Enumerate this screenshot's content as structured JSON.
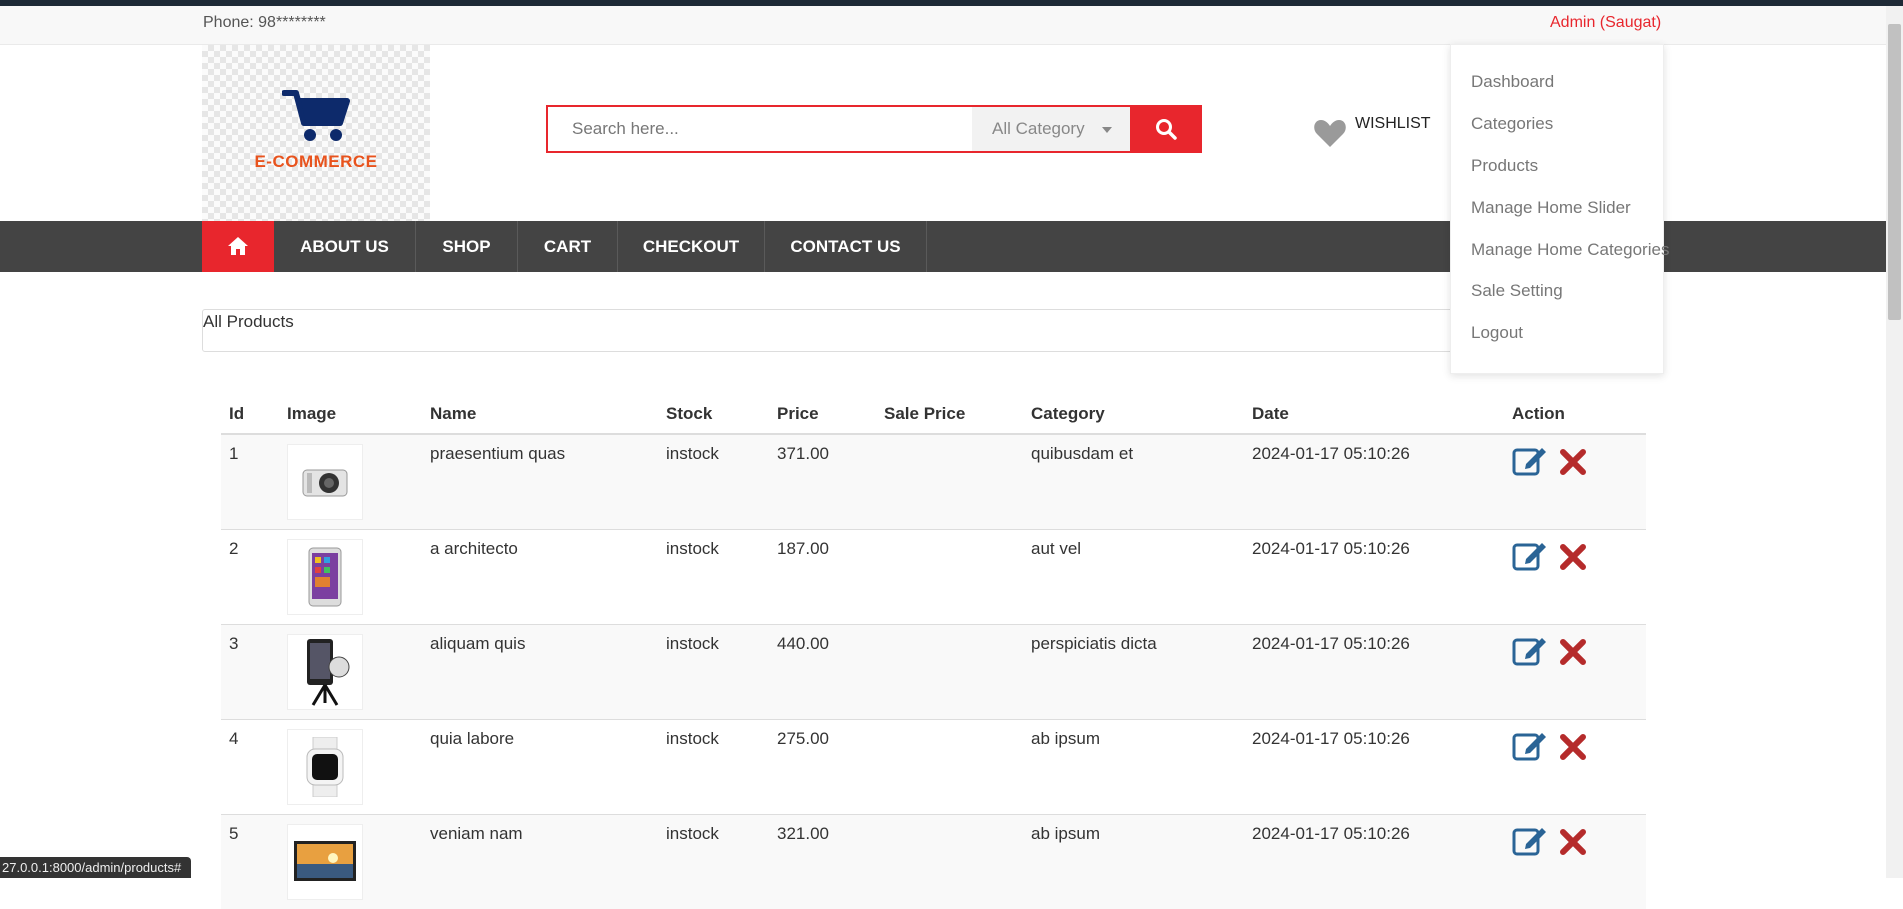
{
  "topbar": {
    "phone": "Phone: 98********",
    "admin_menu": "Admin (Saugat)"
  },
  "header": {
    "logo_text": "E-COMMERCE",
    "search": {
      "placeholder": "Search here...",
      "category_selected": "All Category"
    },
    "wishlist_label": "WISHLIST"
  },
  "nav": {
    "items": [
      "ABOUT US",
      "SHOP",
      "CART",
      "CHECKOUT",
      "CONTACT US"
    ]
  },
  "admin_dropdown": {
    "items": [
      "Dashboard",
      "Categories",
      "Products",
      "Manage Home Slider",
      "Manage Home Categories",
      "Sale Setting",
      "Logout"
    ]
  },
  "panel": {
    "title": "All Products"
  },
  "table": {
    "headers": [
      "Id",
      "Image",
      "Name",
      "Stock",
      "Price",
      "Sale Price",
      "Category",
      "Date",
      "Action"
    ],
    "rows": [
      {
        "id": "1",
        "image": "camera",
        "name": "praesentium quas",
        "stock": "instock",
        "price": "371.00",
        "sale_price": "",
        "category": "quibusdam et",
        "date": "2024-01-17 05:10:26"
      },
      {
        "id": "2",
        "image": "tablet",
        "name": "a architecto",
        "stock": "instock",
        "price": "187.00",
        "sale_price": "",
        "category": "aut vel",
        "date": "2024-01-17 05:10:26"
      },
      {
        "id": "3",
        "image": "phone-tripod",
        "name": "aliquam quis",
        "stock": "instock",
        "price": "440.00",
        "sale_price": "",
        "category": "perspiciatis dicta",
        "date": "2024-01-17 05:10:26"
      },
      {
        "id": "4",
        "image": "smartwatch",
        "name": "quia labore",
        "stock": "instock",
        "price": "275.00",
        "sale_price": "",
        "category": "ab ipsum",
        "date": "2024-01-17 05:10:26"
      },
      {
        "id": "5",
        "image": "tv-landscape",
        "name": "veniam nam",
        "stock": "instock",
        "price": "321.00",
        "sale_price": "",
        "category": "ab ipsum",
        "date": "2024-01-17 05:10:26"
      }
    ]
  },
  "status_bar": {
    "url": "27.0.0.1:8000/admin/products#"
  },
  "colors": {
    "accent": "#e8262d",
    "nav_bg": "#444444",
    "logo_blue": "#0d2a6b",
    "logo_orange": "#e8531d",
    "edit_icon": "#2a6496",
    "delete_icon": "#b52b2b"
  }
}
